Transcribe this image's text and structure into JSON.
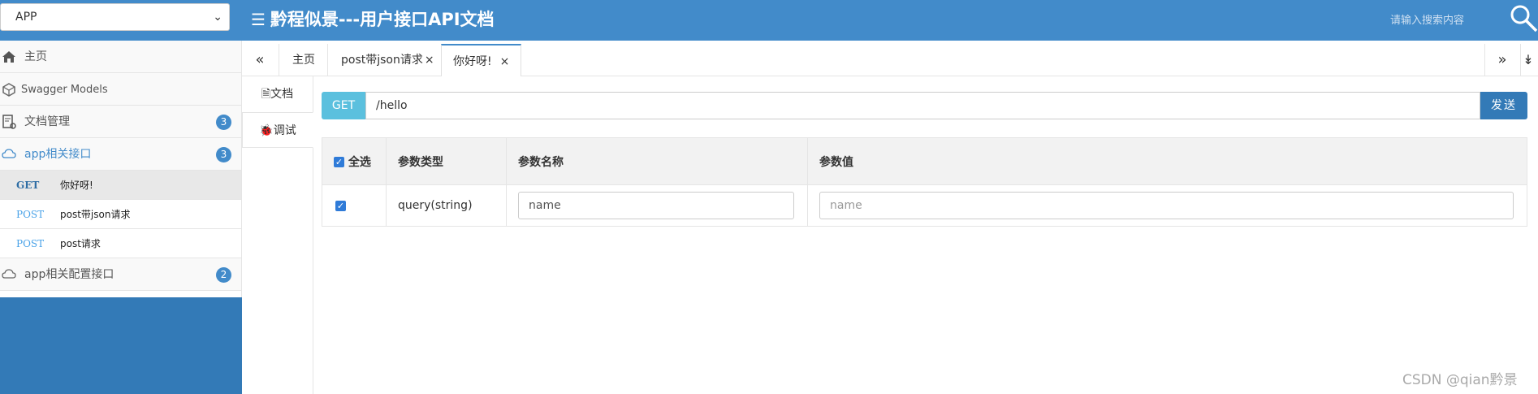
{
  "header": {
    "app_select": "APP",
    "title": "黔程似景---用户接口API文档",
    "search_placeholder": "请输入搜索内容"
  },
  "sidebar": {
    "home": "主页",
    "swagger_models": "Swagger Models",
    "doc_manage": {
      "label": "文档管理",
      "count": "3"
    },
    "app_api": {
      "label": "app相关接口",
      "count": "3"
    },
    "sub_items": [
      {
        "method": "GET",
        "name": "你好呀!"
      },
      {
        "method": "POST",
        "name": "post带json请求"
      },
      {
        "method": "POST",
        "name": "post请求"
      }
    ],
    "app_config": {
      "label": "app相关配置接口",
      "count": "2"
    }
  },
  "tabs": {
    "items": [
      {
        "label": "主页"
      },
      {
        "label": "post带json请求",
        "close": "×"
      },
      {
        "label": "你好呀!",
        "close": "×"
      }
    ]
  },
  "vtabs": {
    "doc": "文档",
    "debug": "调试"
  },
  "request": {
    "method": "GET",
    "url": "/hello",
    "send": "发送"
  },
  "params": {
    "headers": {
      "select_all": "全选",
      "type": "参数类型",
      "name": "参数名称",
      "value": "参数值"
    },
    "rows": [
      {
        "type": "query(string)",
        "name": "name",
        "value_placeholder": "name"
      }
    ]
  },
  "watermark": "CSDN @qian黔景",
  "colors": {
    "header": "#428bca",
    "sidebar_fill": "#337ab7",
    "get_button": "#5bc0de",
    "send_button": "#337ab7"
  }
}
